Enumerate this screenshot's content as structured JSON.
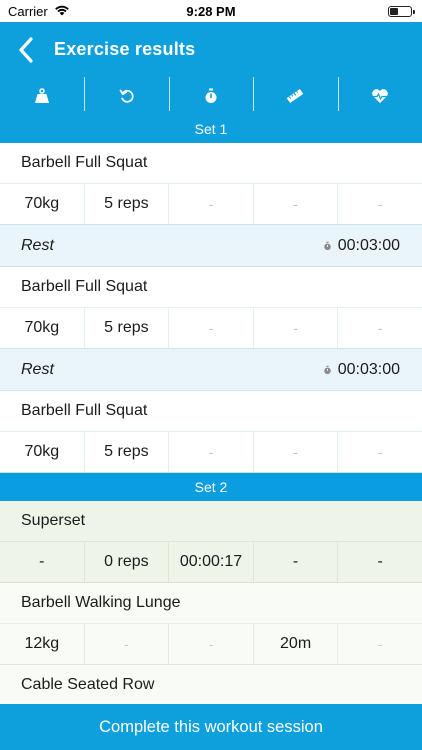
{
  "status": {
    "carrier": "Carrier",
    "time": "9:28 PM"
  },
  "header": {
    "title": "Exercise results"
  },
  "columns": [
    {
      "icon": "weight-icon"
    },
    {
      "icon": "repeat-icon"
    },
    {
      "icon": "stopwatch-icon"
    },
    {
      "icon": "ruler-icon"
    },
    {
      "icon": "heart-rate-icon"
    }
  ],
  "sets": [
    {
      "label": "Set 1",
      "rows": [
        {
          "type": "exercise",
          "name": "Barbell Full Squat",
          "values": [
            "70kg",
            "5 reps",
            "-",
            "-",
            "-"
          ]
        },
        {
          "type": "rest",
          "label": "Rest",
          "time": "00:03:00"
        },
        {
          "type": "exercise",
          "name": "Barbell Full Squat",
          "values": [
            "70kg",
            "5 reps",
            "-",
            "-",
            "-"
          ]
        },
        {
          "type": "rest",
          "label": "Rest",
          "time": "00:03:00"
        },
        {
          "type": "exercise",
          "name": "Barbell Full Squat",
          "values": [
            "70kg",
            "5 reps",
            "-",
            "-",
            "-"
          ]
        }
      ]
    },
    {
      "label": "Set 2",
      "superset": {
        "name": "Superset",
        "values": [
          "-",
          "0 reps",
          "00:00:17",
          "-",
          "-"
        ]
      },
      "rows": [
        {
          "type": "exercise",
          "name": "Barbell Walking Lunge",
          "values": [
            "12kg",
            "-",
            "-",
            "20m",
            "-"
          ]
        },
        {
          "type": "exercise",
          "name": "Cable Seated Row",
          "values": []
        }
      ]
    }
  ],
  "footer": {
    "complete_label": "Complete this workout session"
  },
  "colors": {
    "accent": "#0ea0dd",
    "rest_bg": "#eaf5fb",
    "superset_bg": "#eef4e8"
  }
}
